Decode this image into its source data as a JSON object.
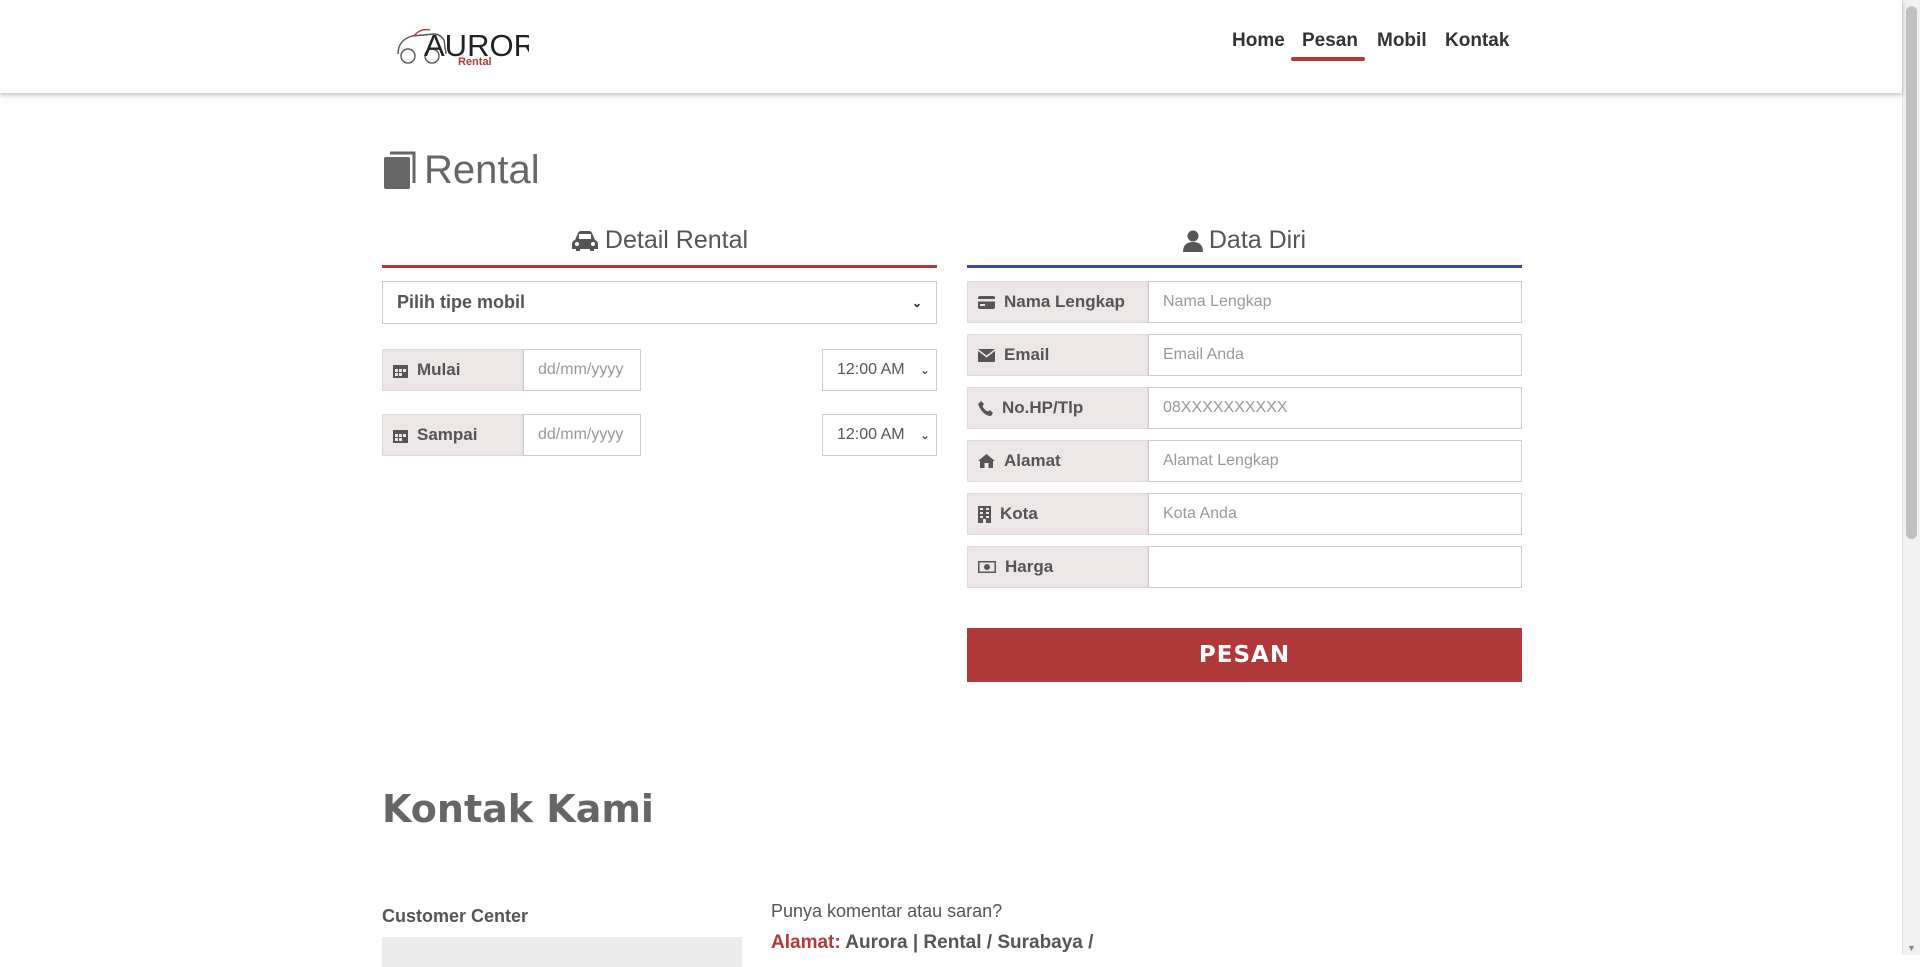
{
  "brand": {
    "name": "AURORA",
    "sub": "Rental"
  },
  "nav": {
    "items": [
      "Home",
      "Pesan",
      "Mobil",
      "Kontak"
    ],
    "active": "Pesan"
  },
  "page": {
    "title": "Rental"
  },
  "detail": {
    "heading": "Detail Rental",
    "car_select": "Pilih tipe mobil",
    "start_label": "Mulai",
    "end_label": "Sampai",
    "date_placeholder": "dd/mm/yyyy",
    "start_time": "12:00 AM",
    "end_time": "12:00 AM"
  },
  "personal": {
    "heading": "Data Diri",
    "fields": [
      {
        "label": "Nama Lengkap",
        "placeholder": "Nama Lengkap",
        "icon": "credit-card-icon"
      },
      {
        "label": "Email",
        "placeholder": "Email Anda",
        "icon": "envelope-icon"
      },
      {
        "label": "No.HP/Tlp",
        "placeholder": "08XXXXXXXXXX",
        "icon": "phone-icon"
      },
      {
        "label": "Alamat",
        "placeholder": "Alamat Lengkap",
        "icon": "home-icon"
      },
      {
        "label": "Kota",
        "placeholder": "Kota Anda",
        "icon": "building-icon"
      },
      {
        "label": "Harga",
        "placeholder": "",
        "icon": "money-icon"
      }
    ],
    "submit": "PESAN"
  },
  "contact": {
    "title": "Kontak Kami",
    "customer_center": "Customer Center",
    "comment_prompt": "Punya komentar atau saran?",
    "address_label": "Alamat:",
    "address_value": "Aurora | Rental / Surabaya /"
  },
  "colors": {
    "accent_red": "#b03a3a",
    "accent_blue": "#3a46a8",
    "addon_bg": "#ece6e6"
  }
}
